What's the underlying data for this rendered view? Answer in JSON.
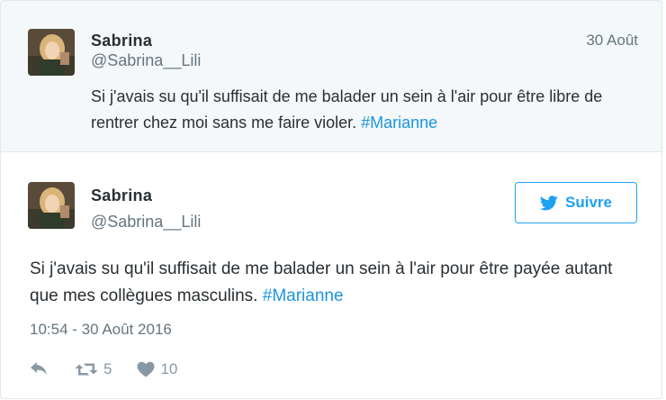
{
  "parent_tweet": {
    "author_name": "Sabrina",
    "author_handle": "@Sabrina__Lili",
    "date": "30 Août",
    "text": "Si j'avais su qu'il suffisait de me balader un sein à l'air pour être libre de rentrer chez moi sans me faire violer.",
    "hashtag": "#Marianne"
  },
  "main_tweet": {
    "author_name": "Sabrina",
    "author_handle": "@Sabrina__Lili",
    "follow_label": "Suivre",
    "text": "Si j'avais su qu'il suffisait de me balader un sein à l'air pour être payée autant que mes collègues masculins.",
    "hashtag": "#Marianne",
    "timestamp": "10:54 - 30 Août 2016",
    "retweet_count": "5",
    "like_count": "10"
  },
  "colors": {
    "accent": "#1da1f2",
    "hashtag": "#1b95e0",
    "muted": "#66757f",
    "icon": "#8899a6",
    "parent_bg": "#f5f8fa",
    "border": "#e1e8ed"
  },
  "icons": {
    "follow": "twitter-bird-icon",
    "reply": "reply-icon",
    "retweet": "retweet-icon",
    "like": "heart-icon"
  }
}
